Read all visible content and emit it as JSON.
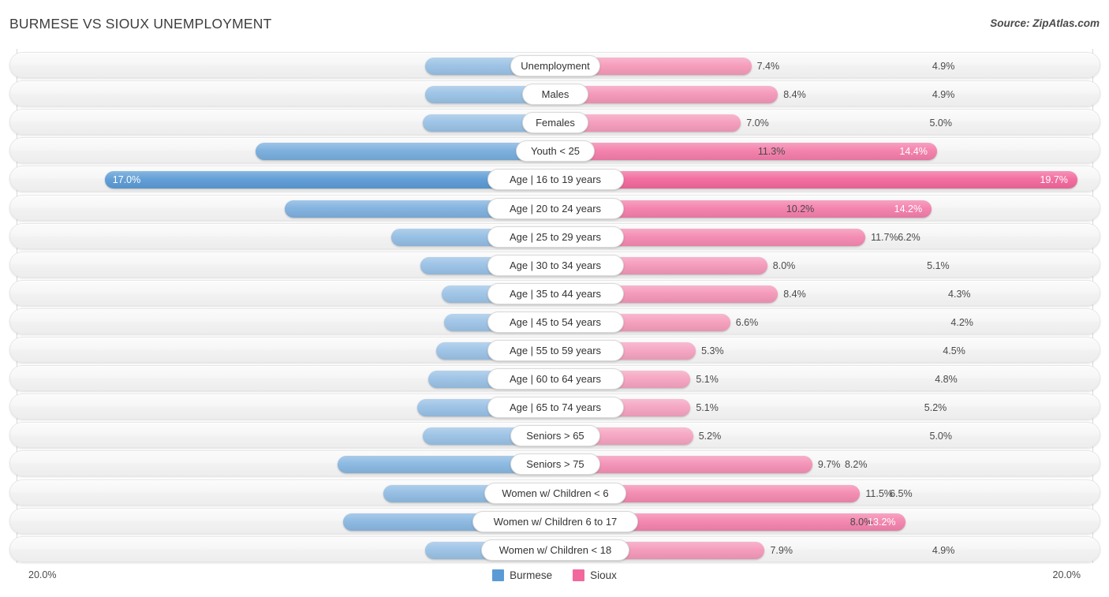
{
  "header": {
    "title": "BURMESE VS SIOUX UNEMPLOYMENT",
    "source": "Source: ZipAtlas.com"
  },
  "axis": {
    "left_label": "20.0%",
    "right_label": "20.0%",
    "max": 20.0
  },
  "legend": {
    "items": [
      {
        "label": "Burmese",
        "color": "#5B9BD5"
      },
      {
        "label": "Sioux",
        "color": "#F2689C"
      }
    ]
  },
  "colors": {
    "blue_light": "#9DC3E6",
    "blue_mid": "#8CB9E3",
    "blue_dark": "#5B9BD5",
    "pink_light": "#F5A3C0",
    "pink_mid": "#F58BB2",
    "pink_dark": "#F2689C",
    "track": "#f4f4f4",
    "gridline": "#d8d8d8"
  },
  "chart_data": {
    "type": "bar",
    "orientation": "horizontal-diverging",
    "title": "BURMESE VS SIOUX UNEMPLOYMENT",
    "xlabel": "",
    "ylabel": "",
    "xlim": [
      20.0,
      20.0
    ],
    "grid": true,
    "legend_position": "bottom-center",
    "categories": [
      "Unemployment",
      "Males",
      "Females",
      "Youth < 25",
      "Age | 16 to 19 years",
      "Age | 20 to 24 years",
      "Age | 25 to 29 years",
      "Age | 30 to 34 years",
      "Age | 35 to 44 years",
      "Age | 45 to 54 years",
      "Age | 55 to 59 years",
      "Age | 60 to 64 years",
      "Age | 65 to 74 years",
      "Seniors > 65",
      "Seniors > 75",
      "Women w/ Children < 6",
      "Women w/ Children 6 to 17",
      "Women w/ Children < 18"
    ],
    "series": [
      {
        "name": "Burmese",
        "color": "#5B9BD5",
        "values": [
          4.9,
          4.9,
          5.0,
          11.3,
          17.0,
          10.2,
          6.2,
          5.1,
          4.3,
          4.2,
          4.5,
          4.8,
          5.2,
          5.0,
          8.2,
          6.5,
          8.0,
          4.9
        ],
        "labels": [
          "4.9%",
          "4.9%",
          "5.0%",
          "11.3%",
          "17.0%",
          "10.2%",
          "6.2%",
          "5.1%",
          "4.3%",
          "4.2%",
          "4.5%",
          "4.8%",
          "5.2%",
          "5.0%",
          "8.2%",
          "6.5%",
          "8.0%",
          "4.9%"
        ]
      },
      {
        "name": "Sioux",
        "color": "#F2689C",
        "values": [
          7.4,
          8.4,
          7.0,
          14.4,
          19.7,
          14.2,
          11.7,
          8.0,
          8.4,
          6.6,
          5.3,
          5.1,
          5.1,
          5.2,
          9.7,
          11.5,
          13.2,
          7.9
        ],
        "labels": [
          "7.4%",
          "8.4%",
          "7.0%",
          "14.4%",
          "19.7%",
          "14.2%",
          "11.7%",
          "8.0%",
          "8.4%",
          "6.6%",
          "5.3%",
          "5.1%",
          "5.1%",
          "5.2%",
          "9.7%",
          "11.5%",
          "13.2%",
          "7.9%"
        ]
      }
    ]
  },
  "rows": [
    {
      "label": "Unemployment",
      "left": "4.9%",
      "right": "7.4%",
      "left_val": 4.9,
      "right_val": 7.4
    },
    {
      "label": "Males",
      "left": "4.9%",
      "right": "8.4%",
      "left_val": 4.9,
      "right_val": 8.4
    },
    {
      "label": "Females",
      "left": "5.0%",
      "right": "7.0%",
      "left_val": 5.0,
      "right_val": 7.0
    },
    {
      "label": "Youth < 25",
      "left": "11.3%",
      "right": "14.4%",
      "left_val": 11.3,
      "right_val": 14.4
    },
    {
      "label": "Age | 16 to 19 years",
      "left": "17.0%",
      "right": "19.7%",
      "left_val": 17.0,
      "right_val": 19.7
    },
    {
      "label": "Age | 20 to 24 years",
      "left": "10.2%",
      "right": "14.2%",
      "left_val": 10.2,
      "right_val": 14.2
    },
    {
      "label": "Age | 25 to 29 years",
      "left": "6.2%",
      "right": "11.7%",
      "left_val": 6.2,
      "right_val": 11.7
    },
    {
      "label": "Age | 30 to 34 years",
      "left": "5.1%",
      "right": "8.0%",
      "left_val": 5.1,
      "right_val": 8.0
    },
    {
      "label": "Age | 35 to 44 years",
      "left": "4.3%",
      "right": "8.4%",
      "left_val": 4.3,
      "right_val": 8.4
    },
    {
      "label": "Age | 45 to 54 years",
      "left": "4.2%",
      "right": "6.6%",
      "left_val": 4.2,
      "right_val": 6.6
    },
    {
      "label": "Age | 55 to 59 years",
      "left": "4.5%",
      "right": "5.3%",
      "left_val": 4.5,
      "right_val": 5.3
    },
    {
      "label": "Age | 60 to 64 years",
      "left": "4.8%",
      "right": "5.1%",
      "left_val": 4.8,
      "right_val": 5.1
    },
    {
      "label": "Age | 65 to 74 years",
      "left": "5.2%",
      "right": "5.1%",
      "left_val": 5.2,
      "right_val": 5.1
    },
    {
      "label": "Seniors > 65",
      "left": "5.0%",
      "right": "5.2%",
      "left_val": 5.0,
      "right_val": 5.2
    },
    {
      "label": "Seniors > 75",
      "left": "8.2%",
      "right": "9.7%",
      "left_val": 8.2,
      "right_val": 9.7
    },
    {
      "label": "Women w/ Children < 6",
      "left": "6.5%",
      "right": "11.5%",
      "left_val": 6.5,
      "right_val": 11.5
    },
    {
      "label": "Women w/ Children 6 to 17",
      "left": "8.0%",
      "right": "13.2%",
      "left_val": 8.0,
      "right_val": 13.2
    },
    {
      "label": "Women w/ Children < 18",
      "left": "4.9%",
      "right": "7.9%",
      "left_val": 4.9,
      "right_val": 7.9
    }
  ]
}
